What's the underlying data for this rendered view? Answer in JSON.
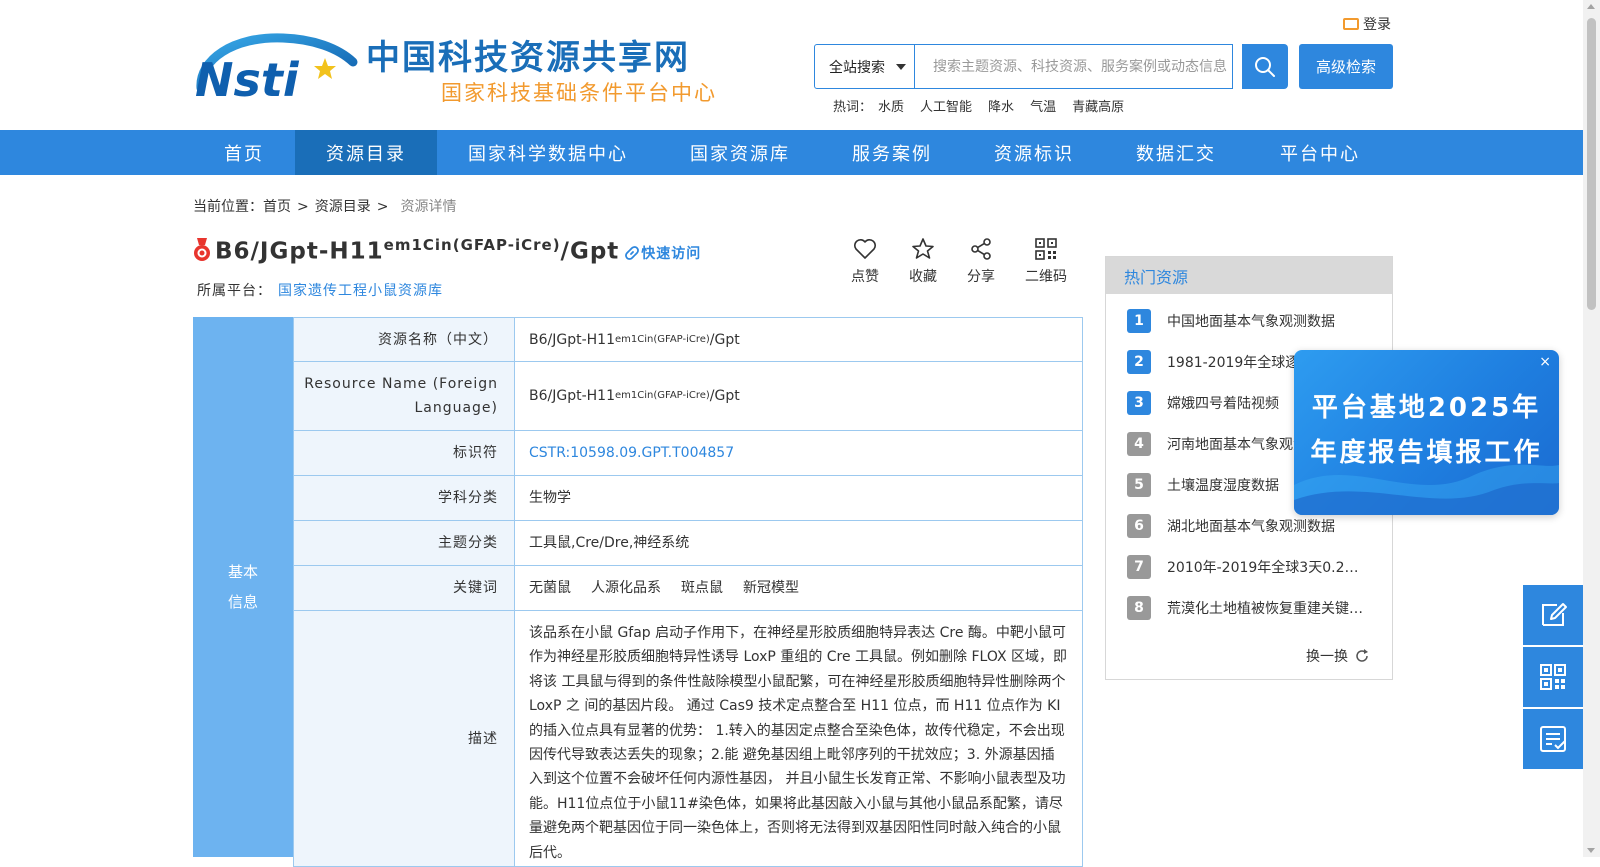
{
  "header": {
    "site_title": "中国科技资源共享网",
    "site_subtitle": "国家科技基础条件平台中心",
    "logo_text": "Nsti",
    "login_label": "登录",
    "search": {
      "scope": "全站搜索",
      "placeholder": "搜索主题资源、科技资源、服务案例或动态信息"
    },
    "advanced_search_label": "高级检索",
    "hot_label": "热词：",
    "hot_words": [
      "水质",
      "人工智能",
      "降水",
      "气温",
      "青藏高原"
    ]
  },
  "nav": {
    "items": [
      "首页",
      "资源目录",
      "国家科学数据中心",
      "国家资源库",
      "服务案例",
      "资源标识",
      "数据汇交",
      "平台中心"
    ],
    "active_index": 1
  },
  "breadcrumb": {
    "prefix": "当前位置：",
    "items": [
      "首页",
      "资源目录"
    ],
    "current": "资源详情"
  },
  "resource": {
    "title_main": "B6/JGpt-H11",
    "title_sup": "em1Cin(GFAP-iCre)",
    "title_tail": "/Gpt",
    "quick_access": "快速访问",
    "platform_label": "所属平台：",
    "platform_name": "国家遗传工程小鼠资源库"
  },
  "actions": [
    {
      "label": "点赞",
      "icon": "heart-icon"
    },
    {
      "label": "收藏",
      "icon": "star-icon"
    },
    {
      "label": "分享",
      "icon": "share-icon"
    },
    {
      "label": "二维码",
      "icon": "qrcode-icon"
    }
  ],
  "info": {
    "section_label": "基本信息",
    "rows": {
      "name_cn_key": "资源名称（中文）",
      "name_cn_main": "B6/JGpt-H11",
      "name_cn_sup": "em1Cin(GFAP-iCre)",
      "name_cn_tail": "/Gpt",
      "name_en_key": "Resource Name (Foreign Language)",
      "name_en_main": "B6/JGpt-H11",
      "name_en_sup": "em1Cin(GFAP-iCre)",
      "name_en_tail": "/Gpt",
      "identifier_key": "标识符",
      "identifier_value": "CSTR:10598.09.GPT.T004857",
      "subject_key": "学科分类",
      "subject_value": "生物学",
      "topic_key": "主题分类",
      "topic_value": "工具鼠,Cre/Dre,神经系统",
      "keywords_key": "关键词",
      "keywords": [
        "无菌鼠",
        "人源化品系",
        "斑点鼠",
        "新冠模型"
      ],
      "description_key": "描述",
      "description_value": "该品系在小鼠 Gfap 启动子作用下，在神经星形胶质细胞特异表达 Cre 酶。中靶小鼠可作为神经星形胶质细胞特异性诱导 LoxP 重组的 Cre 工具鼠。例如删除 FLOX 区域，即将该 工具鼠与得到的条件性敲除模型小鼠配繁，可在神经星形胶质细胞特异性删除两个 LoxP 之 间的基因片段。 通过 Cas9 技术定点整合至 H11 位点，而 H11 位点作为 KI 的插入位点具有显著的优势： 1.转入的基因定点整合至染色体，故传代稳定，不会出现因传代导致表达丢失的现象；2.能 避免基因组上毗邻序列的干扰效应；3. 外源基因插入到这个位置不会破坏任何内源性基因， 并且小鼠生长发育正常、不影响小鼠表型及功能。H11位点位于小鼠11#染色体，如果将此基因敲入小鼠与其他小鼠品系配繁，请尽量避免两个靶基因位于同一染色体上，否则将无法得到双基因阳性同时敲入纯合的小鼠后代。"
    }
  },
  "hot_resources": {
    "title": "热门资源",
    "items": [
      "中国地面基本气象观测数据",
      "1981-2019年全球逐日…",
      "嫦娥四号着陆视频",
      "河南地面基本气象观测数据",
      "土壤温度湿度数据",
      "湖北地面基本气象观测数据",
      "2010年-2019年全球3天0.25°…",
      "荒漠化土地植被恢复重建关键…"
    ],
    "ranks": [
      "1",
      "2",
      "3",
      "4",
      "5",
      "6",
      "7",
      "8"
    ],
    "refresh_label": "换一换"
  },
  "popup": {
    "line1": "平台基地2025年",
    "line2": "年度报告填报工作",
    "close": "×"
  },
  "side_tools": [
    "edit-icon",
    "qrcode-icon",
    "checklist-icon"
  ],
  "colors": {
    "primary": "#2e87de",
    "nav_active": "#1a6eb8",
    "accent_orange": "#f29a2e",
    "side_label_bg": "#6db3f0",
    "key_cell_bg": "#eef5fc"
  }
}
